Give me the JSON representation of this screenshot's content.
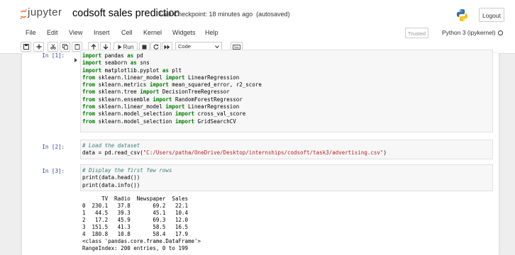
{
  "header": {
    "logo_text": "jupyter",
    "notebook_name": "codsoft sales prediction",
    "checkpoint": "Last Checkpoint: 18 minutes ago",
    "autosave": "(autosaved)",
    "logout_label": "Logout"
  },
  "menu": [
    "File",
    "Edit",
    "View",
    "Insert",
    "Cell",
    "Kernel",
    "Widgets",
    "Help"
  ],
  "status": {
    "trusted_label": "Trusted",
    "kernel_name": "Python 3 (ipykernel)"
  },
  "toolbar": {
    "run_label": "Run",
    "cell_type": "Code"
  },
  "cells": [
    {
      "prompt": "In [1]:",
      "lines": [
        "import pandas as pd",
        "import seaborn as sns",
        "import matplotlib.pyplot as plt",
        "from sklearn.linear_model import LinearRegression",
        "from sklearn.metrics import mean_squared_error, r2_score",
        "from sklearn.tree import DecisionTreeRegressor",
        "from sklearn.ensemble import RandomForestRegressor",
        "from sklearn.linear_model import LinearRegression",
        "from sklearn.model_selection import cross_val_score",
        "from sklearn.model_selection import GridSearchCV"
      ]
    },
    {
      "prompt": "In [2]:",
      "lines": [
        "# Load the dataset",
        "data = pd.read_csv(\"C:/Users/patha/OneDrive/Desktop/internships/codsoft/task3/advertising.csv\")"
      ]
    },
    {
      "prompt": "In [3]:",
      "lines": [
        "# Display the first few rows",
        "print(data.head())",
        "print(data.info())"
      ],
      "output": [
        "      TV  Radio  Newspaper  Sales",
        "0  230.1   37.8       69.2   22.1",
        "1   44.5   39.3       45.1   10.4",
        "2   17.2   45.9       69.3   12.0",
        "3  151.5   41.3       58.5   16.5",
        "4  180.8   10.8       58.4   17.9",
        "<class 'pandas.core.frame.DataFrame'>",
        "RangeIndex: 200 entries, 0 to 199"
      ]
    }
  ],
  "colors": {
    "prompt": "#303f9f",
    "keyword": "#008000",
    "string": "#ba2121",
    "comment": "#408080",
    "jupyter_orange": "#f37726"
  }
}
